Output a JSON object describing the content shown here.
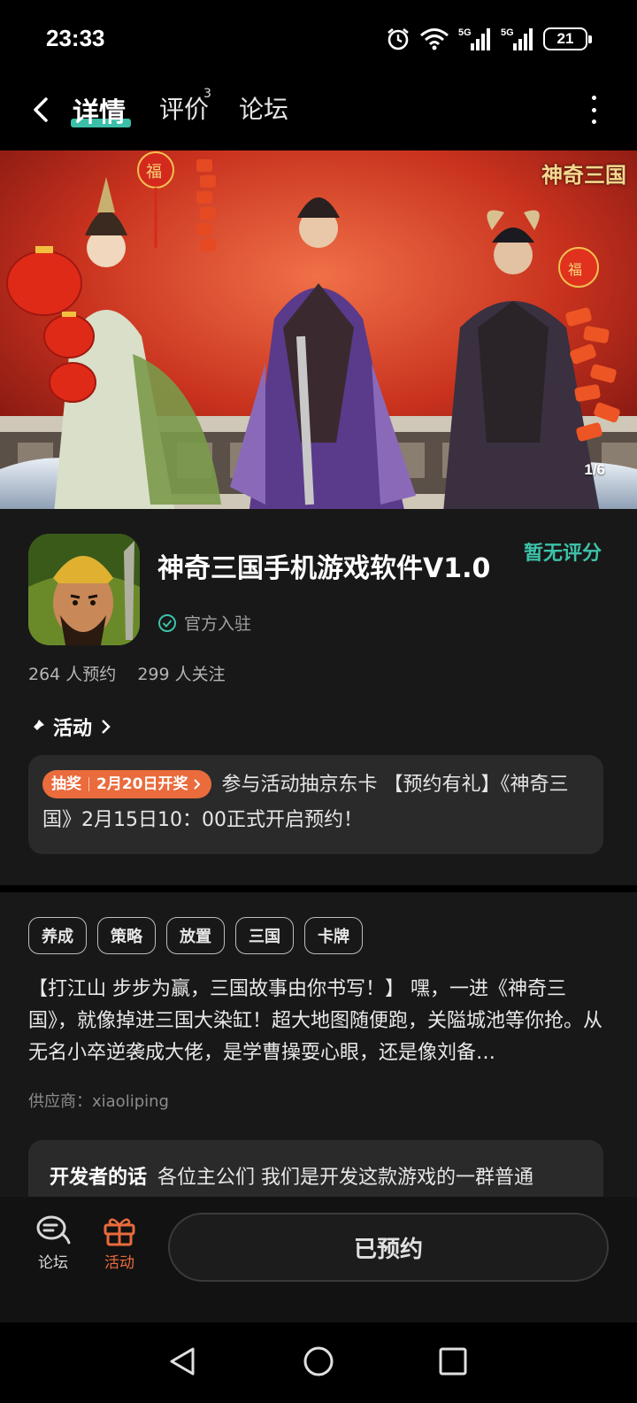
{
  "status_bar": {
    "time": "23:33",
    "battery": "21",
    "signal1": "5G",
    "signal2": "5G"
  },
  "nav": {
    "tabs": [
      {
        "label": "详情",
        "active": true
      },
      {
        "label": "评价",
        "badge": "3"
      },
      {
        "label": "论坛"
      }
    ]
  },
  "banner": {
    "counter": "1/6",
    "logo_text": "神奇三国",
    "fu": "福"
  },
  "app": {
    "title": "神奇三国手机游戏软件V1.0",
    "rating": "暂无评分",
    "official": "官方入驻",
    "reservations": "264 人预约",
    "followers": "299 人关注"
  },
  "activity": {
    "heading": "活动",
    "badge_left": "抽奖",
    "badge_right": "2月20日开奖",
    "text": "参与活动抽京东卡 【预约有礼】《神奇三国》2月15日10：00正式开启预约！"
  },
  "tags": [
    "养成",
    "策略",
    "放置",
    "三国",
    "卡牌"
  ],
  "description": "【打江山 步步为赢，三国故事由你书写！】 嘿，一进《神奇三国》，就像掉进三国大染缸！超大地图随便跑，关隘城池等你抢。从无名小卒逆袭成大佬，是学曹操耍心眼，还是像刘备…",
  "supplier": "供应商：xiaoliping",
  "developer": {
    "label": "开发者的话",
    "text": "各位主公们 我们是开发这款游戏的一群普通"
  },
  "bottom": {
    "forum_label": "论坛",
    "activity_label": "活动",
    "reserve_label": "已预约"
  },
  "colors": {
    "accent": "#3bbfa8",
    "orange": "#ea6b3c",
    "background": "#181818"
  }
}
